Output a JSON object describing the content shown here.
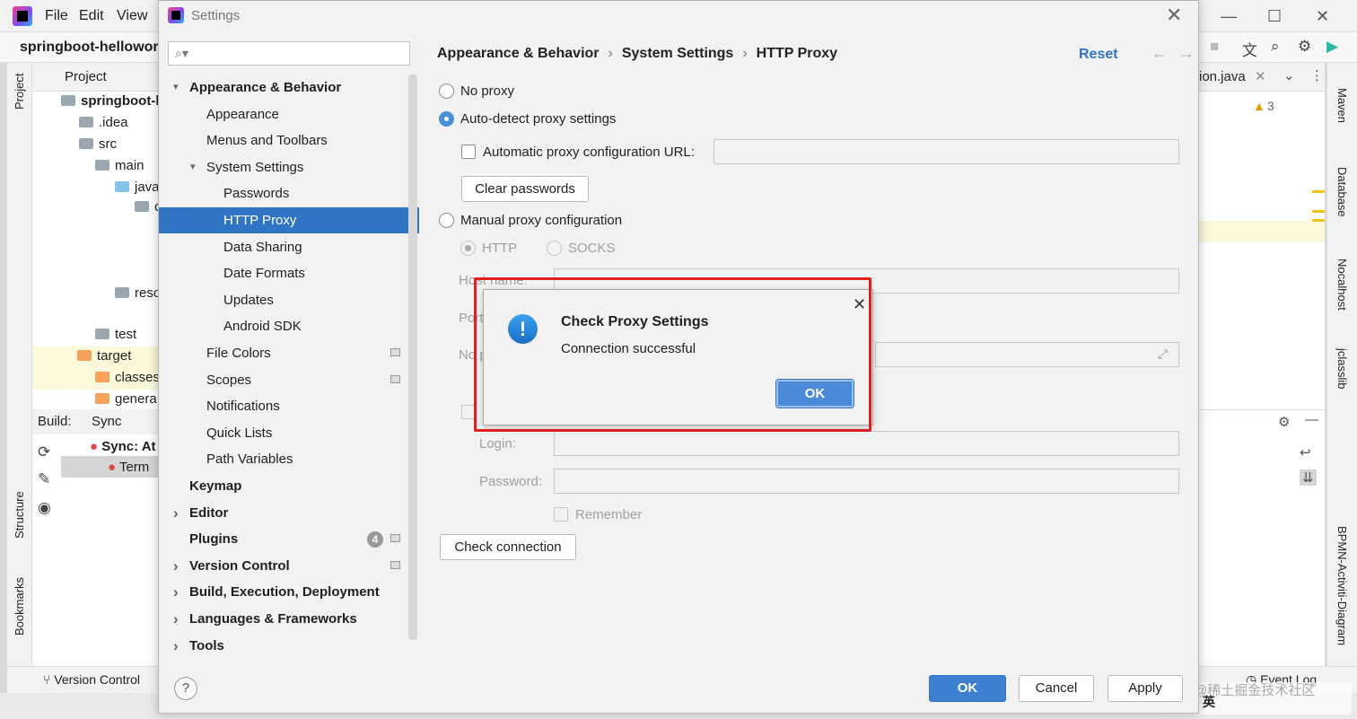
{
  "ide": {
    "menu": [
      "File",
      "Edit",
      "View"
    ],
    "project_name": "springboot-helloword",
    "left_tabs": [
      "Project",
      "Structure",
      "Bookmarks"
    ],
    "project_panel_title": "Project",
    "project_tree": [
      "springboot-h",
      ".idea",
      "src",
      "main",
      "java",
      "c",
      "reso",
      "test",
      "target",
      "classes",
      "genera"
    ],
    "build_tab": "Build:",
    "sync_tab": "Sync",
    "sync_item": "Sync: At",
    "sync_sub": "Term",
    "version_control": "Version Control",
    "editor_tab": "ion.java",
    "warning_count": "3",
    "right_tabs": [
      "Maven",
      "Database",
      "Nocalhost",
      "jclasslib",
      "BPMN-Activiti-Diagram"
    ],
    "event_log": "Event Log",
    "watermark": "@稀土掘金技术社区",
    "ime_label": "英"
  },
  "dialog": {
    "title": "Settings",
    "search_placeholder": "",
    "tree": [
      {
        "label": "Appearance & Behavior",
        "bold": true,
        "indent": 0,
        "arrow": "down"
      },
      {
        "label": "Appearance",
        "indent": 1
      },
      {
        "label": "Menus and Toolbars",
        "indent": 1
      },
      {
        "label": "System Settings",
        "indent": 1,
        "arrow": "down"
      },
      {
        "label": "Passwords",
        "indent": 2
      },
      {
        "label": "HTTP Proxy",
        "indent": 2,
        "selected": true
      },
      {
        "label": "Data Sharing",
        "indent": 2
      },
      {
        "label": "Date Formats",
        "indent": 2
      },
      {
        "label": "Updates",
        "indent": 2
      },
      {
        "label": "Android SDK",
        "indent": 2
      },
      {
        "label": "File Colors",
        "indent": 1,
        "marker": true
      },
      {
        "label": "Scopes",
        "indent": 1,
        "marker": true
      },
      {
        "label": "Notifications",
        "indent": 1
      },
      {
        "label": "Quick Lists",
        "indent": 1
      },
      {
        "label": "Path Variables",
        "indent": 1
      },
      {
        "label": "Keymap",
        "bold": true,
        "indent": 0
      },
      {
        "label": "Editor",
        "bold": true,
        "indent": 0,
        "arrow": "right"
      },
      {
        "label": "Plugins",
        "bold": true,
        "indent": 0,
        "badge": "4",
        "marker": true
      },
      {
        "label": "Version Control",
        "bold": true,
        "indent": 0,
        "arrow": "right",
        "marker": true
      },
      {
        "label": "Build, Execution, Deployment",
        "bold": true,
        "indent": 0,
        "arrow": "right"
      },
      {
        "label": "Languages & Frameworks",
        "bold": true,
        "indent": 0,
        "arrow": "right"
      },
      {
        "label": "Tools",
        "bold": true,
        "indent": 0,
        "arrow": "right"
      }
    ],
    "breadcrumbs": [
      "Appearance & Behavior",
      "System Settings",
      "HTTP Proxy"
    ],
    "reset": "Reset",
    "no_proxy": "No proxy",
    "auto_detect": "Auto-detect proxy settings",
    "auto_config_url": "Automatic proxy configuration URL:",
    "clear_passwords": "Clear passwords",
    "manual_proxy": "Manual proxy configuration",
    "http": "HTTP",
    "socks": "SOCKS",
    "host_name": "Host name:",
    "port": "Port",
    "no_proxy_for": "No p",
    "login": "Login:",
    "password": "Password:",
    "remember": "Remember",
    "check_connection": "Check connection",
    "ok": "OK",
    "cancel": "Cancel",
    "apply": "Apply",
    "help": "?"
  },
  "popup": {
    "title": "Check Proxy Settings",
    "message": "Connection successful",
    "ok": "OK",
    "icon_glyph": "!"
  },
  "colors": {
    "selection": "#2f75c4",
    "highlight_frame": "#e02020",
    "primary_button": "#3d7fd0"
  }
}
